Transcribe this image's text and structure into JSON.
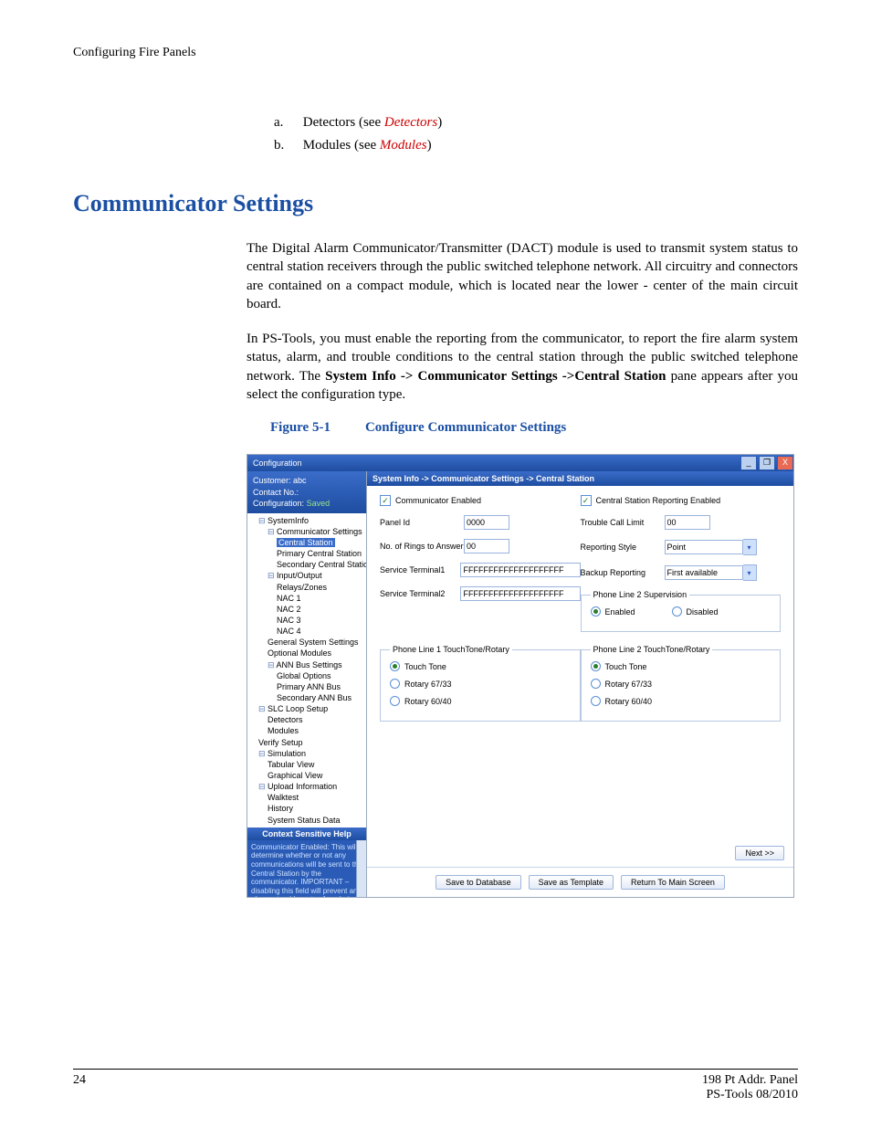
{
  "header": {
    "running": "Configuring Fire Panels"
  },
  "list": {
    "a": {
      "marker": "a.",
      "pre": "Detectors (see ",
      "link": "Detectors",
      "post": ")"
    },
    "b": {
      "marker": "b.",
      "pre": "Modules (see ",
      "link": "Modules",
      "post": ")"
    }
  },
  "section": {
    "title": "Communicator Settings"
  },
  "para1": "The Digital Alarm Communicator/Transmitter (DACT) module is used to transmit system status to central station receivers through the public switched telephone network. All circuitry and connectors are contained on a compact module, which is located near the lower - center of the main circuit board.",
  "para2_pre": "In PS-Tools, you must enable the reporting from the communicator, to report the fire alarm system status, alarm, and trouble conditions to the central station through the public switched telephone network. The ",
  "para2_bold": "System Info -> Communicator Settings ->Central Station",
  "para2_post": " pane appears after you select the configuration type.",
  "figure": {
    "num": "Figure 5-1",
    "cap": "Configure Communicator Settings"
  },
  "shot": {
    "title": "Configuration",
    "info": {
      "customer_l": "Customer:",
      "customer_v": "abc",
      "contact_l": "Contact No.:",
      "contact_v": "",
      "config_l": "Configuration:",
      "config_v": "Saved"
    },
    "tree": {
      "n0": "SystemInfo",
      "n1": "Communicator Settings",
      "n2": "Central Station",
      "n3": "Primary Central Station",
      "n4": "Secondary Central Station",
      "n5": "Input/Output",
      "n6": "Relays/Zones",
      "n7": "NAC 1",
      "n8": "NAC 2",
      "n9": "NAC 3",
      "n10": "NAC 4",
      "n11": "General System Settings",
      "n12": "Optional Modules",
      "n13": "ANN Bus Settings",
      "n14": "Global Options",
      "n15": "Primary ANN Bus",
      "n16": "Secondary ANN Bus",
      "n17": "SLC Loop Setup",
      "n18": "Detectors",
      "n19": "Modules",
      "n20": "Verify Setup",
      "n21": "Simulation",
      "n22": "Tabular View",
      "n23": "Graphical View",
      "n24": "Upload Information",
      "n25": "Walktest",
      "n26": "History",
      "n27": "System Status Data"
    },
    "help": {
      "hdr": "Context Sensitive Help",
      "txt": "Communicator Enabled: This will determine whether or not any communications will be sent to the Central Station by the communicator. IMPORTANT – disabling this field will prevent any alarms, troubles, etc., from being reported to the Central Station.  Number of Rings: This field determines the number of rings allowed on the phone line prior to answering an"
    },
    "crumb": "System Info -> Communicator Settings -> Central Station",
    "form": {
      "comm_enabled": "Communicator Enabled",
      "cs_enabled": "Central Station Reporting Enabled",
      "panel_id_l": "Panel Id",
      "panel_id_v": "0000",
      "rings_l": "No. of Rings to Answer",
      "rings_v": "00",
      "st1_l": "Service Terminal1",
      "st1_v": "FFFFFFFFFFFFFFFFFFFF",
      "st2_l": "Service Terminal2",
      "st2_v": "FFFFFFFFFFFFFFFFFFFF",
      "tcl_l": "Trouble Call Limit",
      "tcl_v": "00",
      "rstyle_l": "Reporting Style",
      "rstyle_v": "Point",
      "brep_l": "Backup Reporting",
      "brep_v": "First available",
      "sup_legend": "Phone Line 2 Supervision",
      "enabled": "Enabled",
      "disabled": "Disabled",
      "ttr1_legend": "Phone Line 1 TouchTone/Rotary",
      "ttr2_legend": "Phone Line 2 TouchTone/Rotary",
      "opt_tt": "Touch Tone",
      "opt_67": "Rotary 67/33",
      "opt_60": "Rotary 60/40"
    },
    "buttons": {
      "next": "Next >>",
      "save_db": "Save to Database",
      "save_tpl": "Save as Template",
      "return": "Return To Main Screen"
    }
  },
  "footer": {
    "page": "24",
    "prod": "198 Pt Addr. Panel",
    "tool": "PS-Tools  08/2010"
  }
}
